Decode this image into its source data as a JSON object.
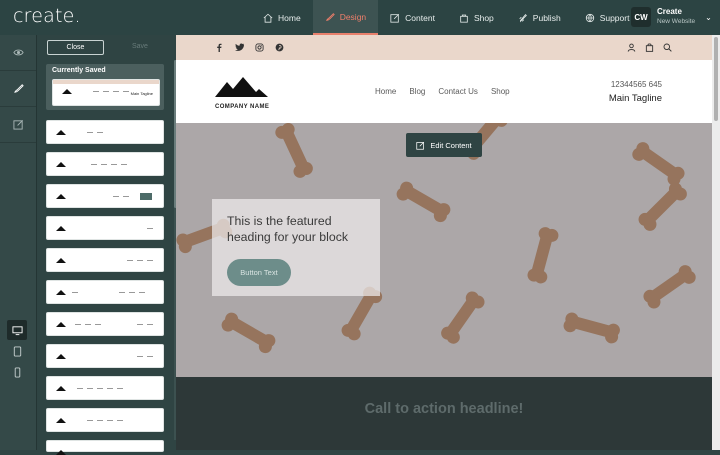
{
  "app": {
    "logo": "create."
  },
  "nav": [
    {
      "label": "Home",
      "icon": "home-icon",
      "active": false
    },
    {
      "label": "Design",
      "icon": "brush-icon",
      "active": true
    },
    {
      "label": "Content",
      "icon": "edit-icon",
      "active": false
    },
    {
      "label": "Shop",
      "icon": "bag-icon",
      "active": false
    },
    {
      "label": "Publish",
      "icon": "rocket-icon",
      "active": false
    },
    {
      "label": "Support",
      "icon": "globe-icon",
      "active": false
    }
  ],
  "account": {
    "initials": "CW",
    "name": "Create",
    "subtitle": "New Website"
  },
  "panel": {
    "close_label": "Close",
    "save_label": "Save",
    "currently_saved_label": "Currently Saved",
    "saved_thumb_tagline": "Main Tagline"
  },
  "site": {
    "company_name": "COMPANY NAME",
    "nav": [
      "Home",
      "Blog",
      "Contact Us",
      "Shop"
    ],
    "phone": "12344565 645",
    "tagline": "Main Tagline"
  },
  "hero": {
    "edit_label": "Edit Content",
    "heading": "This is the featured heading for your block",
    "button_text": "Button Text"
  },
  "cta": {
    "headline": "Call to action headline!"
  },
  "colors": {
    "brand_dark": "#2c4443",
    "accent": "#e8806c",
    "social_bar": "#ead7cb"
  }
}
